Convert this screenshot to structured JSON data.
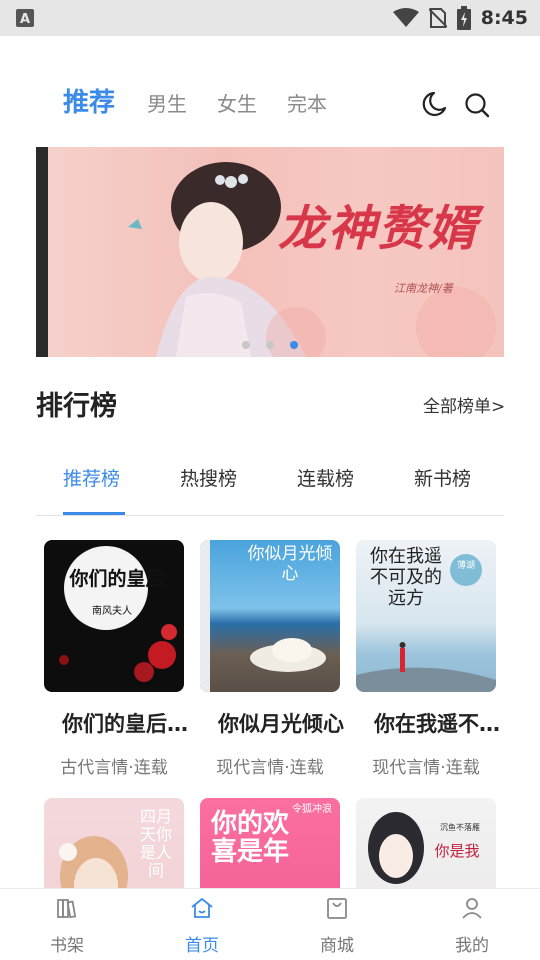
{
  "status_bar": {
    "time": "8:45",
    "icons": [
      "notification-a-icon",
      "wifi-icon",
      "no-sim-icon",
      "battery-icon"
    ]
  },
  "top_tabs": [
    {
      "label": "推荐",
      "active": true
    },
    {
      "label": "男生",
      "active": false
    },
    {
      "label": "女生",
      "active": false
    },
    {
      "label": "完本",
      "active": false
    }
  ],
  "header_icons": [
    "moon-icon",
    "search-icon"
  ],
  "banner": {
    "title": "龙神赘婿",
    "author": "江南龙神/著",
    "dots": 3,
    "active_dot": 3
  },
  "ranking": {
    "title": "排行榜",
    "all_link": "全部榜单>",
    "tabs": [
      {
        "label": "推荐榜",
        "active": true
      },
      {
        "label": "热搜榜",
        "active": false
      },
      {
        "label": "连载榜",
        "active": false
      },
      {
        "label": "新书榜",
        "active": false
      }
    ]
  },
  "books": [
    {
      "title": "你们的皇后…",
      "meta": "古代言情·连载",
      "cover_text": "你们的皇后",
      "cover_sub": "南风夫人"
    },
    {
      "title": "你似月光倾心",
      "meta": "现代言情·连载",
      "cover_text": "你似月光倾心"
    },
    {
      "title": "你在我遥不…",
      "meta": "现代言情·连载",
      "cover_text": "你在我遥不可及的远方",
      "cover_sub": "薄湖"
    },
    {
      "cover_text": "四月天你是人间"
    },
    {
      "cover_text": "你的欢喜是年",
      "cover_sub": "令狐冲浪"
    },
    {
      "cover_text": "你是我",
      "cover_sub": "沉鱼不落雁"
    }
  ],
  "bottom_nav": [
    {
      "label": "书架",
      "icon": "bookshelf-icon",
      "active": false
    },
    {
      "label": "首页",
      "icon": "home-icon",
      "active": true
    },
    {
      "label": "商城",
      "icon": "store-icon",
      "active": false
    },
    {
      "label": "我的",
      "icon": "profile-icon",
      "active": false
    }
  ],
  "colors": {
    "accent": "#3d8be8",
    "banner_title": "#d8374a"
  }
}
